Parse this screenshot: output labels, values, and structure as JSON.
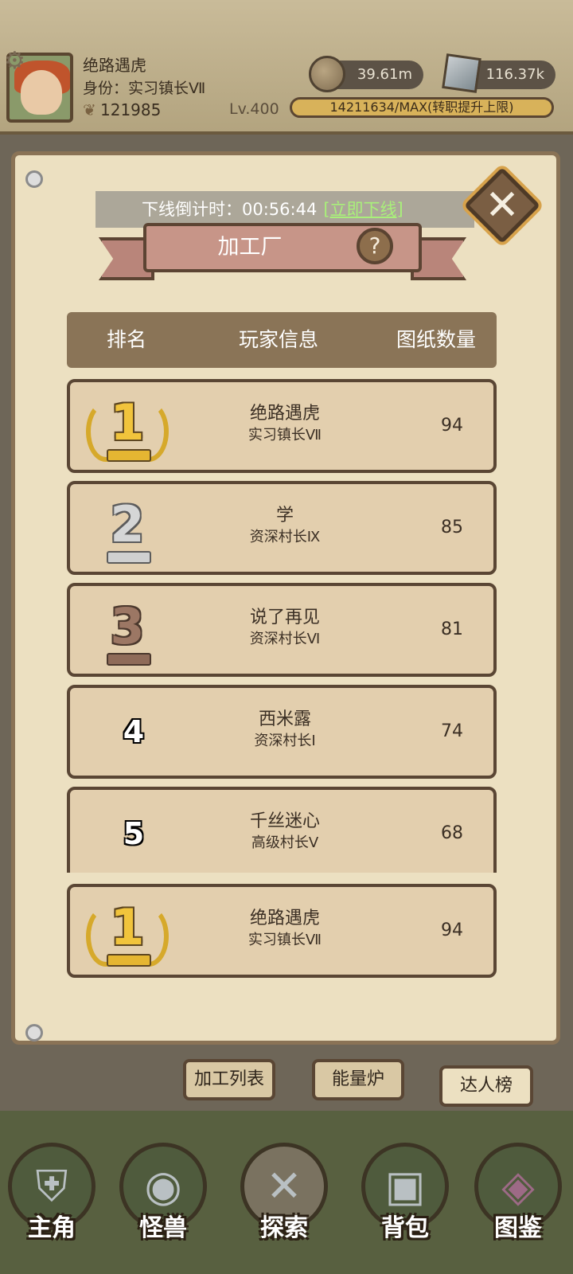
{
  "header": {
    "player_name": "绝路遇虎",
    "identity": "身份：实习镇长Ⅶ",
    "power": "121985",
    "level": "Lv.400",
    "coins": "39.61m",
    "gems": "116.37k",
    "exp": "14211634/MAX(转职提升上限)"
  },
  "dialog": {
    "countdown_label": "下线倒计时：00:56:44",
    "go_offline_link": "[立即下线]",
    "title": "加工厂",
    "help": "?",
    "close": "✕"
  },
  "table": {
    "columns": [
      "排名",
      "玩家信息",
      "图纸数量"
    ],
    "rows": [
      {
        "rank": "1",
        "name": "绝路遇虎",
        "title": "实习镇长Ⅶ",
        "count": "94"
      },
      {
        "rank": "2",
        "name": "学",
        "title": "资深村长Ⅸ",
        "count": "85"
      },
      {
        "rank": "3",
        "name": "说了再见",
        "title": "资深村长Ⅵ",
        "count": "81"
      },
      {
        "rank": "4",
        "name": "西米露",
        "title": "资深村长Ⅰ",
        "count": "74"
      },
      {
        "rank": "5",
        "name": "千丝迷心",
        "title": "高级村长Ⅴ",
        "count": "68"
      }
    ],
    "self_row": {
      "rank": "1",
      "name": "绝路遇虎",
      "title": "实习镇长Ⅶ",
      "count": "94"
    }
  },
  "tabs": [
    "加工列表",
    "能量炉",
    "达人榜"
  ],
  "nav": [
    "主角",
    "怪兽",
    "探索",
    "背包",
    "图鉴"
  ],
  "icons": {
    "gear": "settings-gear-icon",
    "coin": "coin-icon",
    "gem": "gem-icon",
    "close": "close-icon",
    "help": "help-icon"
  },
  "colors": {
    "parchment": "#ece0c1",
    "header_bar": "#8a7457",
    "row_bg": "#e3cfae",
    "exp_bar": "#d8b25a",
    "offline_link": "#a9f07a"
  }
}
